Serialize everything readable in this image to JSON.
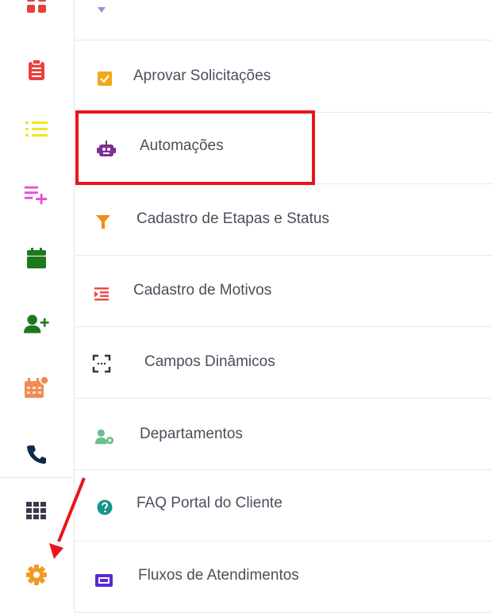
{
  "rail": {
    "icons": [
      {
        "name": "dashboard-icon",
        "color": "#e8403e"
      },
      {
        "name": "clipboard-list-icon",
        "color": "#e8403e"
      },
      {
        "name": "list-icon",
        "color": "#f2e61f"
      },
      {
        "name": "playlist-add-icon",
        "color": "#e84ad9"
      },
      {
        "name": "calendar-icon",
        "color": "#1c7a1c"
      },
      {
        "name": "user-plus-icon",
        "color": "#1c7a1c"
      },
      {
        "name": "calendar-alert-icon",
        "color": "#f08a55"
      },
      {
        "name": "phone-icon",
        "color": "#0f2a4a"
      },
      {
        "name": "apps-grid-icon",
        "color": "#3a3a4e"
      },
      {
        "name": "gear-icon",
        "color": "#f29a1f"
      }
    ]
  },
  "menu": {
    "items": [
      {
        "label": "Aprovar Solicitações",
        "icon": "checkbox-icon",
        "color": "#f3a71b"
      },
      {
        "label": "Automações",
        "icon": "robot-icon",
        "color": "#7b2f8e"
      },
      {
        "label": "Cadastro de Etapas e Status",
        "icon": "filter-icon",
        "color": "#f58a12"
      },
      {
        "label": "Cadastro de Motivos",
        "icon": "format-indent-icon",
        "color": "#ea4c3f"
      },
      {
        "label": "Campos Dinâmicos",
        "icon": "focus-frame-icon",
        "color": "#333344"
      },
      {
        "label": "Departamentos",
        "icon": "users-gear-icon",
        "color": "#6cbf8a"
      },
      {
        "label": "FAQ Portal do Cliente",
        "icon": "question-circle-icon",
        "color": "#16948a"
      },
      {
        "label": "Fluxos de Atendimentos",
        "icon": "ticket-icon",
        "color": "#5a2ad6"
      }
    ]
  },
  "colors": {
    "highlight_border": "#e8161b",
    "annotation_arrow": "#e8161b"
  }
}
